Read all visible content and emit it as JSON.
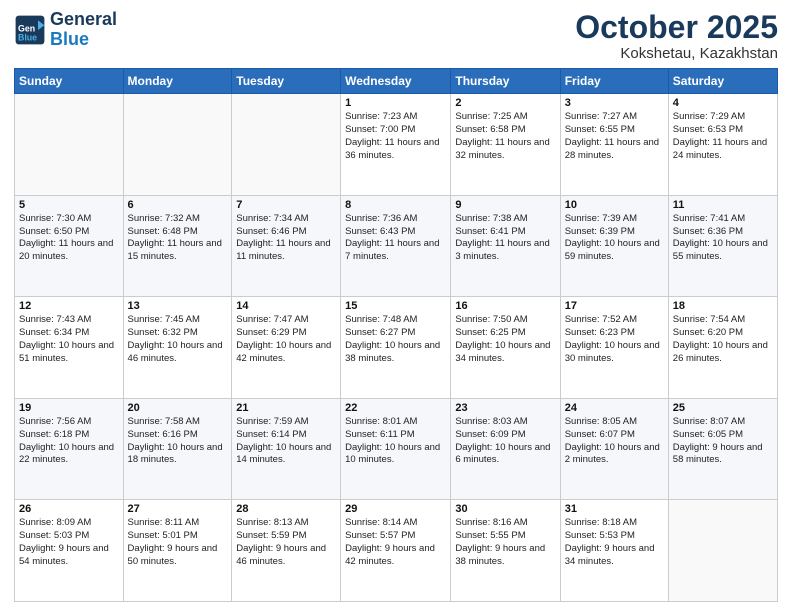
{
  "header": {
    "logo_line1": "General",
    "logo_line2": "Blue",
    "month": "October 2025",
    "location": "Kokshetau, Kazakhstan"
  },
  "weekdays": [
    "Sunday",
    "Monday",
    "Tuesday",
    "Wednesday",
    "Thursday",
    "Friday",
    "Saturday"
  ],
  "weeks": [
    [
      {
        "day": "",
        "sunrise": "",
        "sunset": "",
        "daylight": ""
      },
      {
        "day": "",
        "sunrise": "",
        "sunset": "",
        "daylight": ""
      },
      {
        "day": "",
        "sunrise": "",
        "sunset": "",
        "daylight": ""
      },
      {
        "day": "1",
        "sunrise": "Sunrise: 7:23 AM",
        "sunset": "Sunset: 7:00 PM",
        "daylight": "Daylight: 11 hours and 36 minutes."
      },
      {
        "day": "2",
        "sunrise": "Sunrise: 7:25 AM",
        "sunset": "Sunset: 6:58 PM",
        "daylight": "Daylight: 11 hours and 32 minutes."
      },
      {
        "day": "3",
        "sunrise": "Sunrise: 7:27 AM",
        "sunset": "Sunset: 6:55 PM",
        "daylight": "Daylight: 11 hours and 28 minutes."
      },
      {
        "day": "4",
        "sunrise": "Sunrise: 7:29 AM",
        "sunset": "Sunset: 6:53 PM",
        "daylight": "Daylight: 11 hours and 24 minutes."
      }
    ],
    [
      {
        "day": "5",
        "sunrise": "Sunrise: 7:30 AM",
        "sunset": "Sunset: 6:50 PM",
        "daylight": "Daylight: 11 hours and 20 minutes."
      },
      {
        "day": "6",
        "sunrise": "Sunrise: 7:32 AM",
        "sunset": "Sunset: 6:48 PM",
        "daylight": "Daylight: 11 hours and 15 minutes."
      },
      {
        "day": "7",
        "sunrise": "Sunrise: 7:34 AM",
        "sunset": "Sunset: 6:46 PM",
        "daylight": "Daylight: 11 hours and 11 minutes."
      },
      {
        "day": "8",
        "sunrise": "Sunrise: 7:36 AM",
        "sunset": "Sunset: 6:43 PM",
        "daylight": "Daylight: 11 hours and 7 minutes."
      },
      {
        "day": "9",
        "sunrise": "Sunrise: 7:38 AM",
        "sunset": "Sunset: 6:41 PM",
        "daylight": "Daylight: 11 hours and 3 minutes."
      },
      {
        "day": "10",
        "sunrise": "Sunrise: 7:39 AM",
        "sunset": "Sunset: 6:39 PM",
        "daylight": "Daylight: 10 hours and 59 minutes."
      },
      {
        "day": "11",
        "sunrise": "Sunrise: 7:41 AM",
        "sunset": "Sunset: 6:36 PM",
        "daylight": "Daylight: 10 hours and 55 minutes."
      }
    ],
    [
      {
        "day": "12",
        "sunrise": "Sunrise: 7:43 AM",
        "sunset": "Sunset: 6:34 PM",
        "daylight": "Daylight: 10 hours and 51 minutes."
      },
      {
        "day": "13",
        "sunrise": "Sunrise: 7:45 AM",
        "sunset": "Sunset: 6:32 PM",
        "daylight": "Daylight: 10 hours and 46 minutes."
      },
      {
        "day": "14",
        "sunrise": "Sunrise: 7:47 AM",
        "sunset": "Sunset: 6:29 PM",
        "daylight": "Daylight: 10 hours and 42 minutes."
      },
      {
        "day": "15",
        "sunrise": "Sunrise: 7:48 AM",
        "sunset": "Sunset: 6:27 PM",
        "daylight": "Daylight: 10 hours and 38 minutes."
      },
      {
        "day": "16",
        "sunrise": "Sunrise: 7:50 AM",
        "sunset": "Sunset: 6:25 PM",
        "daylight": "Daylight: 10 hours and 34 minutes."
      },
      {
        "day": "17",
        "sunrise": "Sunrise: 7:52 AM",
        "sunset": "Sunset: 6:23 PM",
        "daylight": "Daylight: 10 hours and 30 minutes."
      },
      {
        "day": "18",
        "sunrise": "Sunrise: 7:54 AM",
        "sunset": "Sunset: 6:20 PM",
        "daylight": "Daylight: 10 hours and 26 minutes."
      }
    ],
    [
      {
        "day": "19",
        "sunrise": "Sunrise: 7:56 AM",
        "sunset": "Sunset: 6:18 PM",
        "daylight": "Daylight: 10 hours and 22 minutes."
      },
      {
        "day": "20",
        "sunrise": "Sunrise: 7:58 AM",
        "sunset": "Sunset: 6:16 PM",
        "daylight": "Daylight: 10 hours and 18 minutes."
      },
      {
        "day": "21",
        "sunrise": "Sunrise: 7:59 AM",
        "sunset": "Sunset: 6:14 PM",
        "daylight": "Daylight: 10 hours and 14 minutes."
      },
      {
        "day": "22",
        "sunrise": "Sunrise: 8:01 AM",
        "sunset": "Sunset: 6:11 PM",
        "daylight": "Daylight: 10 hours and 10 minutes."
      },
      {
        "day": "23",
        "sunrise": "Sunrise: 8:03 AM",
        "sunset": "Sunset: 6:09 PM",
        "daylight": "Daylight: 10 hours and 6 minutes."
      },
      {
        "day": "24",
        "sunrise": "Sunrise: 8:05 AM",
        "sunset": "Sunset: 6:07 PM",
        "daylight": "Daylight: 10 hours and 2 minutes."
      },
      {
        "day": "25",
        "sunrise": "Sunrise: 8:07 AM",
        "sunset": "Sunset: 6:05 PM",
        "daylight": "Daylight: 9 hours and 58 minutes."
      }
    ],
    [
      {
        "day": "26",
        "sunrise": "Sunrise: 8:09 AM",
        "sunset": "Sunset: 5:03 PM",
        "daylight": "Daylight: 9 hours and 54 minutes."
      },
      {
        "day": "27",
        "sunrise": "Sunrise: 8:11 AM",
        "sunset": "Sunset: 5:01 PM",
        "daylight": "Daylight: 9 hours and 50 minutes."
      },
      {
        "day": "28",
        "sunrise": "Sunrise: 8:13 AM",
        "sunset": "Sunset: 5:59 PM",
        "daylight": "Daylight: 9 hours and 46 minutes."
      },
      {
        "day": "29",
        "sunrise": "Sunrise: 8:14 AM",
        "sunset": "Sunset: 5:57 PM",
        "daylight": "Daylight: 9 hours and 42 minutes."
      },
      {
        "day": "30",
        "sunrise": "Sunrise: 8:16 AM",
        "sunset": "Sunset: 5:55 PM",
        "daylight": "Daylight: 9 hours and 38 minutes."
      },
      {
        "day": "31",
        "sunrise": "Sunrise: 8:18 AM",
        "sunset": "Sunset: 5:53 PM",
        "daylight": "Daylight: 9 hours and 34 minutes."
      },
      {
        "day": "",
        "sunrise": "",
        "sunset": "",
        "daylight": ""
      }
    ]
  ]
}
